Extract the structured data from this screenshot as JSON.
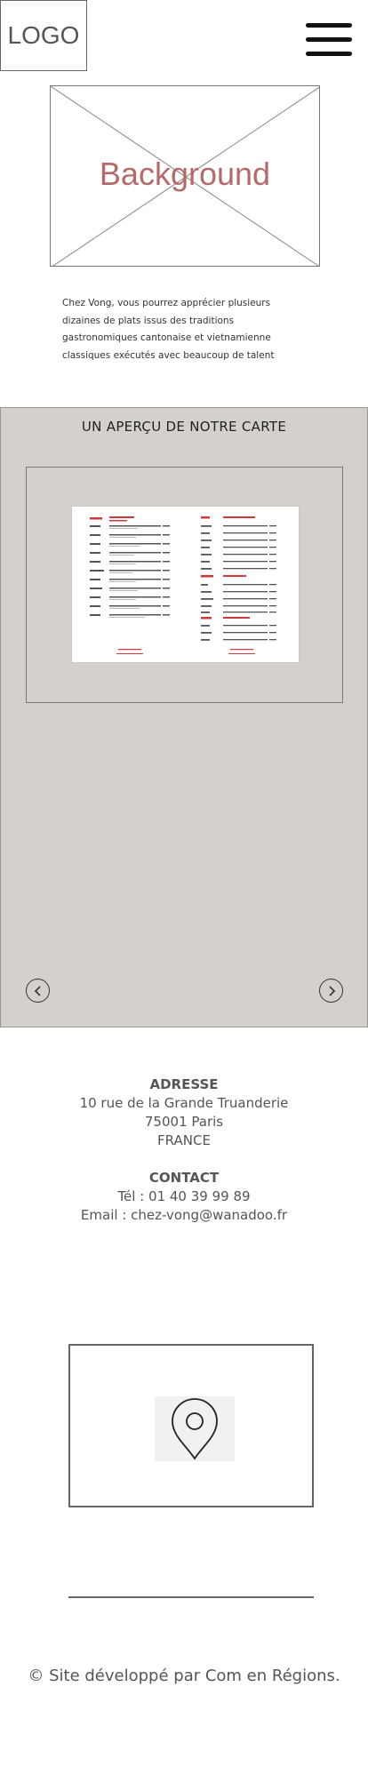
{
  "header": {
    "logo_text": "LOGO",
    "menu_icon": "hamburger-icon"
  },
  "hero": {
    "label": "Background",
    "label_color": "#b56a6a"
  },
  "intro": {
    "text": "Chez Vong, vous pourrez apprécier plusieurs dizaines de plats issus des traditions gastronomiques cantonaise et vietnamienne classiques exécutés avec beaucoup de talent"
  },
  "menu_section": {
    "title": "UN APERÇU DE NOTRE CARTE",
    "background": "#d4d0cc",
    "prev_icon": "chevron-left-circle-icon",
    "next_icon": "chevron-right-circle-icon"
  },
  "address": {
    "heading": "ADRESSE",
    "line1": "10 rue de la Grande Truanderie",
    "line2": "75001 Paris",
    "line3": "FRANCE"
  },
  "contact": {
    "heading": "CONTACT",
    "phone": "Tél : 01 40 39 99 89",
    "email": "Email : chez-vong@wanadoo.fr"
  },
  "map": {
    "icon": "location-pin-icon"
  },
  "footer": {
    "credit": "© Site développé par Com en Régions."
  }
}
